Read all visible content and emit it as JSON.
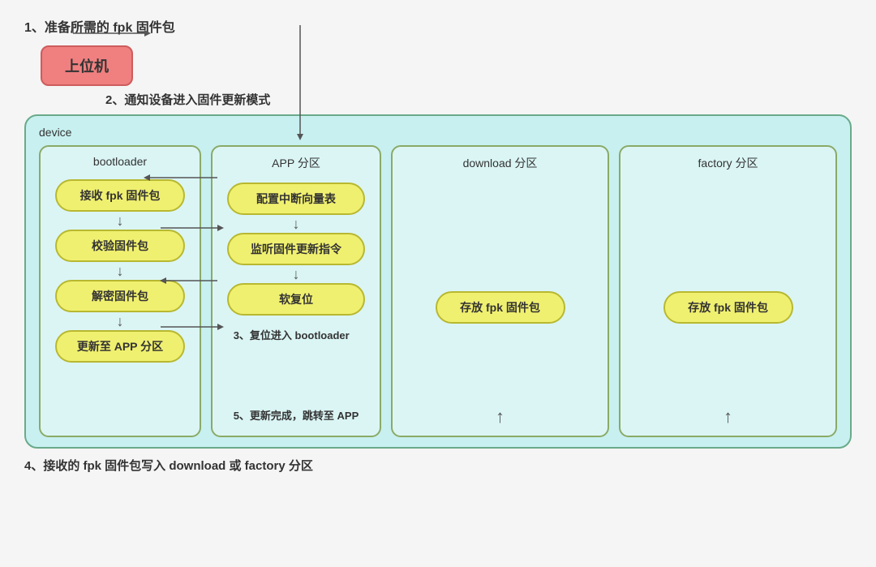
{
  "step1": "1、准备所需的 fpk 固件包",
  "step2": "2、通知设备进入固件更新模式",
  "step4": "4、接收的 fpk 固件包写入 download 或 factory 分区",
  "device_label": "device",
  "partitions": {
    "bootloader": {
      "title": "bootloader",
      "pills": [
        "接收 fpk 固件包",
        "校验固件包",
        "解密固件包",
        "更新至 APP 分区"
      ]
    },
    "app": {
      "title": "APP 分区",
      "pills": [
        "配置中断向量表",
        "监听固件更新指令",
        "软复位"
      ],
      "step3": "3、复位进入 bootloader",
      "step5": "5、更新完成，跳转至 APP"
    },
    "download": {
      "title": "download 分区",
      "store": "存放 fpk 固件包"
    },
    "factory": {
      "title": "factory 分区",
      "store": "存放 fpk 固件包"
    }
  },
  "shangweiji": "上位机"
}
